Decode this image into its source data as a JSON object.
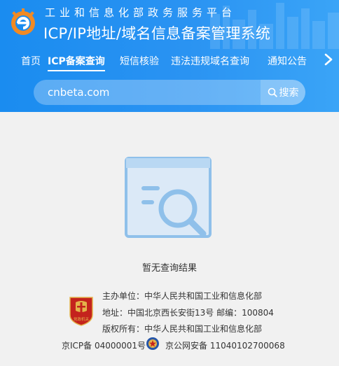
{
  "header": {
    "subtitle": "工业和信息化部政务服务平台",
    "title": "ICP/IP地址/域名信息备案管理系统",
    "brand_color": "#1a8cf0"
  },
  "nav": {
    "items": [
      {
        "label": "首页",
        "active": false
      },
      {
        "label": "ICP备案查询",
        "active": true
      },
      {
        "label": "短信核验",
        "active": false
      },
      {
        "label": "违法违规域名查询",
        "active": false
      },
      {
        "label": "通知公告",
        "active": false
      }
    ],
    "more_icon": "chevron-right-icon"
  },
  "search": {
    "value": "cnbeta.com",
    "button_label": "搜索",
    "button_icon": "search-icon"
  },
  "result": {
    "empty_text": "暂无查询结果",
    "icon": "document-search-icon"
  },
  "footer": {
    "host": "主办单位：中华人民共和国工业和信息化部",
    "address": "地址：中国北京西长安街13号 邮编：100804",
    "copyright": "版权所有：中华人民共和国工业和信息化部",
    "icp": "京ICP备 04000001号",
    "police": "京公网安备 11040102700068",
    "badge_text": "党政机关"
  }
}
